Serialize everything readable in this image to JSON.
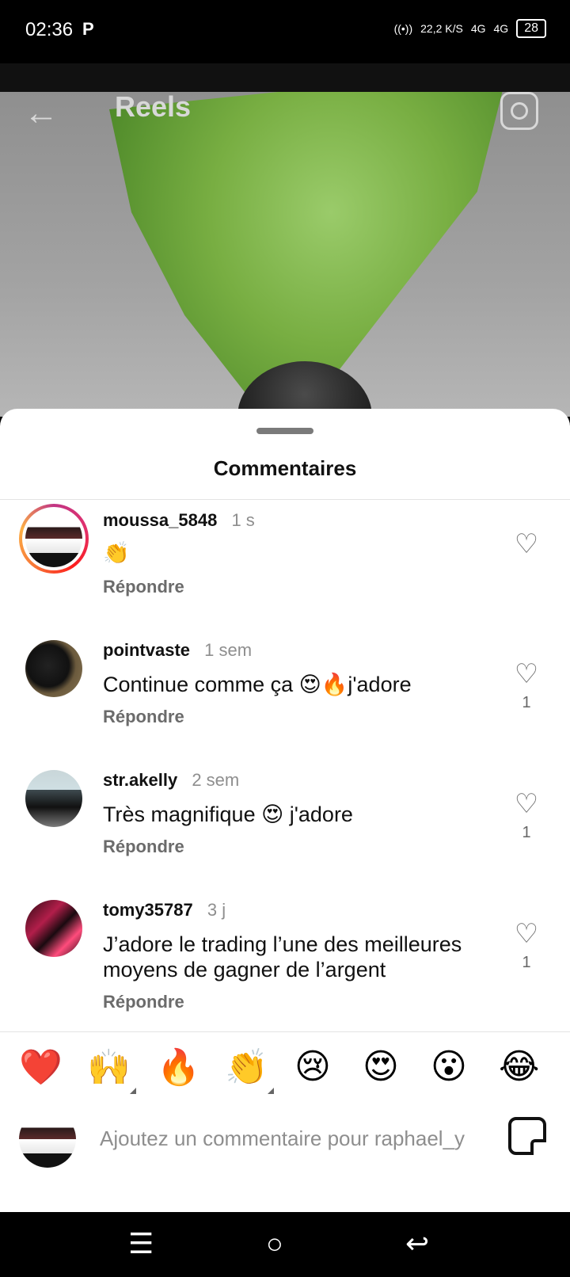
{
  "status_bar": {
    "time": "02:36",
    "left_icons": "P",
    "network_speed": "22,2 K/S",
    "signal_1": "4G",
    "signal_2": "4G",
    "battery": "28"
  },
  "header": {
    "title": "Reels",
    "back_icon": "arrow-left-icon",
    "camera_icon": "camera-icon"
  },
  "sheet": {
    "title": "Commentaires"
  },
  "comments": [
    {
      "username": "moussa_5848",
      "time": "1 s",
      "text": "👏",
      "reply": "Répondre",
      "likes": ""
    },
    {
      "username": "pointvaste",
      "time": "1 sem",
      "text": "Continue comme ça 😍🔥j'adore",
      "reply": "Répondre",
      "likes": "1"
    },
    {
      "username": "str.akelly",
      "time": "2 sem",
      "text": "Très magnifique 😍 j'adore",
      "reply": "Répondre",
      "likes": "1"
    },
    {
      "username": "tomy35787",
      "time": "3 j",
      "text": "J’adore le trading l’une des meilleures moyens de gagner de l’argent",
      "reply": "Répondre",
      "likes": "1"
    }
  ],
  "emoji_bar": [
    "❤️",
    "🙌",
    "🔥",
    "👏",
    "😢",
    "😍",
    "😮",
    "😂"
  ],
  "composer": {
    "placeholder": "Ajoutez un commentaire pour raphael_y"
  },
  "system_nav": {
    "menu": "☰",
    "home": "○",
    "back": "↩"
  }
}
